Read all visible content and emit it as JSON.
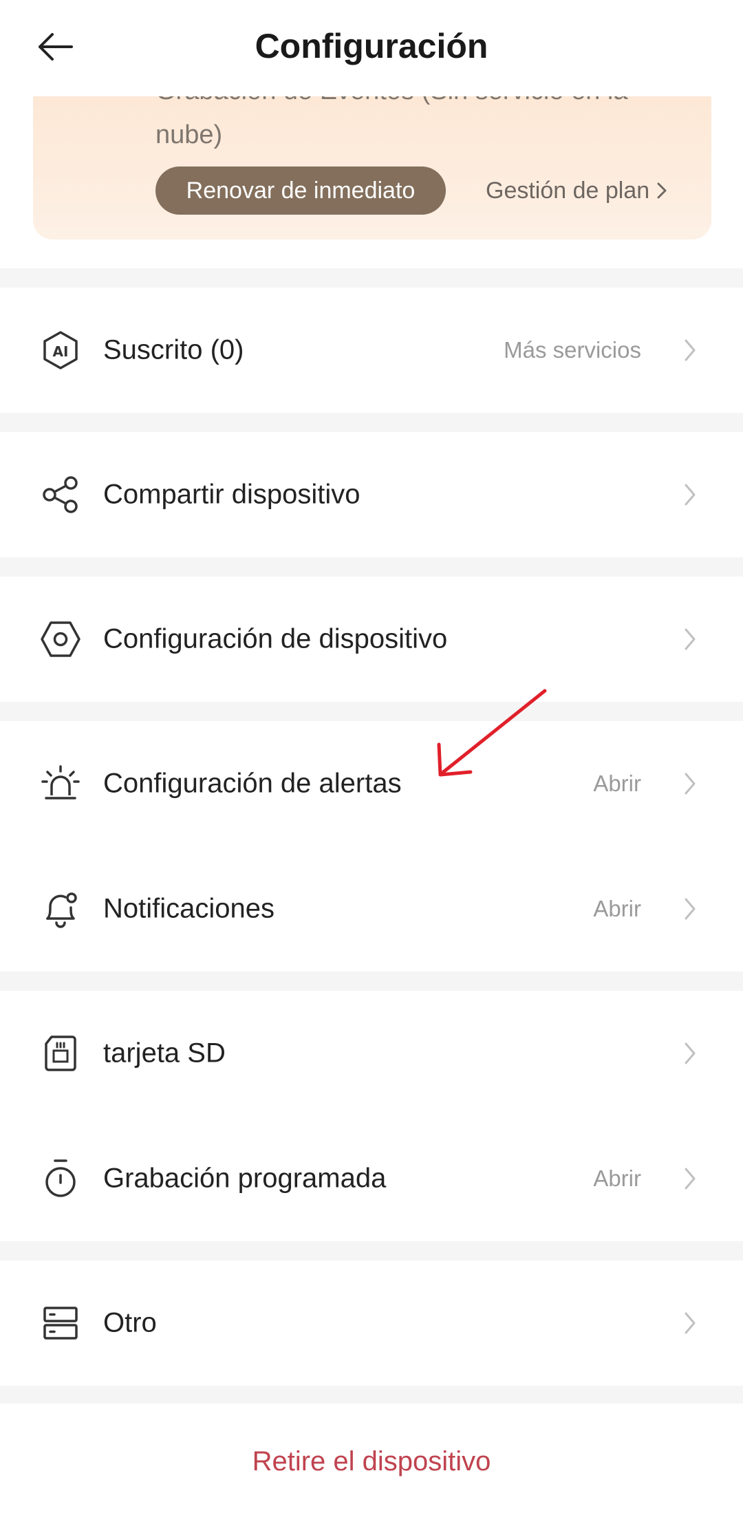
{
  "header": {
    "title": "Configuración",
    "back_icon": "arrow-left-icon"
  },
  "cloud_card": {
    "text": "Grabación de Eventos (Sin servicio en la nube)",
    "renew_label": "Renovar de inmediato",
    "plan_label": "Gestión de plan"
  },
  "groups": [
    {
      "items": [
        {
          "icon": "ai-hexagon-icon",
          "label": "Suscrito (0)",
          "value": "Más servicios"
        }
      ]
    },
    {
      "items": [
        {
          "icon": "share-icon",
          "label": "Compartir dispositivo",
          "value": ""
        }
      ]
    },
    {
      "items": [
        {
          "icon": "hexagon-settings-icon",
          "label": "Configuración de dispositivo",
          "value": ""
        }
      ]
    },
    {
      "items": [
        {
          "icon": "alarm-siren-icon",
          "label": "Configuración de alertas",
          "value": "Abrir"
        },
        {
          "icon": "bell-icon",
          "label": "Notificaciones",
          "value": "Abrir"
        }
      ]
    },
    {
      "items": [
        {
          "icon": "sd-card-icon",
          "label": "tarjeta SD",
          "value": ""
        },
        {
          "icon": "stopwatch-icon",
          "label": "Grabación programada",
          "value": "Abrir"
        }
      ]
    },
    {
      "items": [
        {
          "icon": "server-icon",
          "label": "Otro",
          "value": ""
        }
      ]
    }
  ],
  "remove_label": "Retire el dispositivo",
  "colors": {
    "accent_red": "#c0434f",
    "renew_button": "#836f5c",
    "card_bg": "#fde8d6",
    "annotation_arrow": "#e0202a"
  }
}
